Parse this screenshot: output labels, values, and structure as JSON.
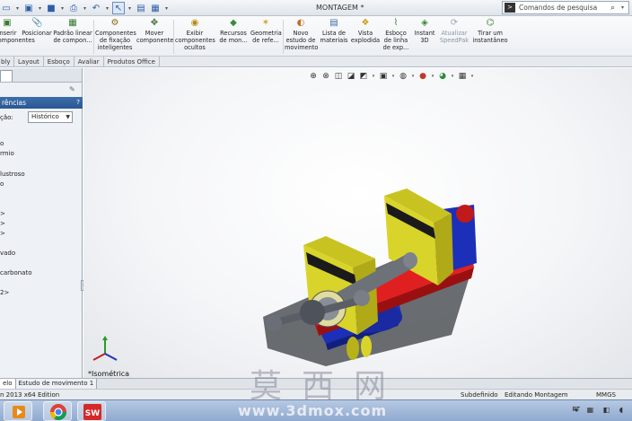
{
  "titlebar": {
    "document_title": "MONTAGEM *",
    "search_placeholder": "Comandos de pesquisa",
    "cmd_badge": "C:\\"
  },
  "ribbon": {
    "buttons": [
      {
        "label": "Inserir\ncomponentes",
        "icon": "insert-components-icon"
      },
      {
        "label": "Posicionar",
        "icon": "mate-icon"
      },
      {
        "label": "Padrão linear\nde compon...",
        "icon": "linear-pattern-icon"
      },
      {
        "label": "Componentes\nde fixação\ninteligentes",
        "icon": "smart-fasteners-icon"
      },
      {
        "label": "Mover\ncomponente",
        "icon": "move-component-icon"
      },
      {
        "label": "Exibir\ncomponentes\nocultos",
        "icon": "show-hidden-icon"
      },
      {
        "label": "Recursos\nde mon...",
        "icon": "assembly-features-icon"
      },
      {
        "label": "Geometria\nde refe...",
        "icon": "reference-geometry-icon"
      },
      {
        "label": "Novo\nestudo de\nmovimento",
        "icon": "motion-study-icon"
      },
      {
        "label": "Lista de\nmateriais",
        "icon": "bom-icon"
      },
      {
        "label": "Vista\nexplodida",
        "icon": "exploded-view-icon"
      },
      {
        "label": "Esboço\nde linha\nde exp...",
        "icon": "explode-line-icon"
      },
      {
        "label": "Instant\n3D",
        "icon": "instant3d-icon"
      },
      {
        "label": "Atualizar\nSpeedPak",
        "icon": "speedpak-icon"
      },
      {
        "label": "Tirar um\ninstantâneo",
        "icon": "snapshot-icon"
      }
    ]
  },
  "tabs": [
    "bly",
    "Layout",
    "Esboço",
    "Avaliar",
    "Produtos Office"
  ],
  "left_panel": {
    "header": "rências",
    "header_help": "?",
    "label": "ção:",
    "select_value": "Histórico",
    "items": [
      "o",
      "rmio",
      "",
      "",
      "lustroso",
      "o",
      "",
      "",
      ">",
      ">",
      ">",
      "",
      "vado",
      "",
      "carbonato",
      "",
      "2>"
    ]
  },
  "viewport": {
    "view_label": "*Isométrica"
  },
  "bottom_tabs": [
    "elo",
    "Estudo de movimento 1"
  ],
  "status": {
    "edition": "n 2013 x64 Edition",
    "state": "Subdefinido",
    "mode": "Editando Montagem",
    "units": "MMGS"
  },
  "taskbar": {
    "lang": "PT"
  },
  "watermark": {
    "chinese": "莫西网",
    "url": "www.3dmox.com"
  },
  "colors": {
    "ribbon_accent": "#2b5793",
    "part_yellow": "#d8d42a",
    "part_red": "#e02020",
    "part_blue": "#1c2fb8"
  }
}
